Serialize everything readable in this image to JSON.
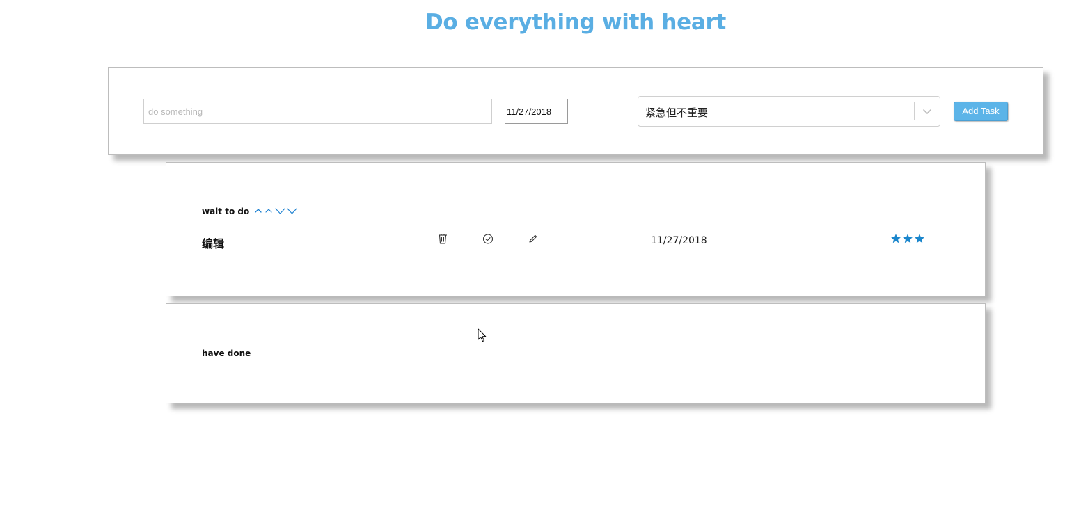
{
  "app": {
    "title": "Do everything with heart"
  },
  "form": {
    "task_placeholder": "do something",
    "task_value": "",
    "date_value": "11/27/2018",
    "priority_selected": "紧急但不重要",
    "add_button_label": "Add Task"
  },
  "todo": {
    "heading": "wait to do",
    "sort_icons": [
      "chevron-up-icon",
      "chevron-up-icon",
      "chevron-down-icon",
      "chevron-down-icon"
    ],
    "tasks": [
      {
        "name": "编辑",
        "date": "11/27/2018",
        "actions": [
          "trash-icon",
          "check-circle-icon",
          "pencil-icon"
        ],
        "stars": 3
      }
    ]
  },
  "done": {
    "heading": "have done",
    "tasks": []
  },
  "colors": {
    "accent": "#5aaee3",
    "button": "#5cb4e8",
    "star": "#1a86cc",
    "sort_icon": "#1a7fd0"
  }
}
